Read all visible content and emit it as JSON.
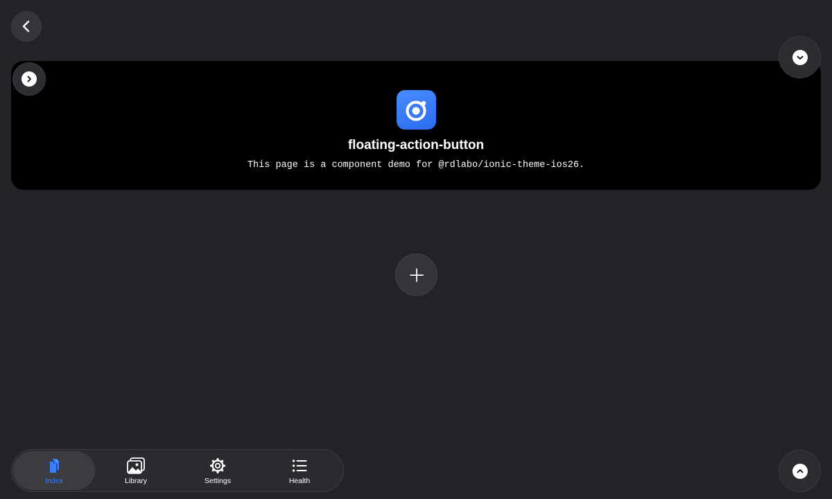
{
  "header": {
    "back_icon": "chevron-back-icon"
  },
  "fab_top": {
    "icon": "chevron-down-circle-icon"
  },
  "card": {
    "start_icon": "chevron-forward-circle-icon",
    "logo_icon": "ionic-logo-icon",
    "title": "floating-action-button",
    "description": "This page is a component demo for @rdlabo/ionic-theme-ios26."
  },
  "fab_center": {
    "icon": "add-icon"
  },
  "fab_bottom": {
    "icon": "chevron-up-circle-icon"
  },
  "tabbar": {
    "tabs": [
      {
        "label": "Index",
        "icon": "documents-icon",
        "selected": true
      },
      {
        "label": "Library",
        "icon": "images-icon",
        "selected": false
      },
      {
        "label": "Settings",
        "icon": "cog-icon",
        "selected": false
      },
      {
        "label": "Health",
        "icon": "list-icon",
        "selected": false
      }
    ]
  },
  "colors": {
    "background": "#222326",
    "accent": "#3880ff",
    "card": "#000000",
    "logo": "#3880ff"
  }
}
